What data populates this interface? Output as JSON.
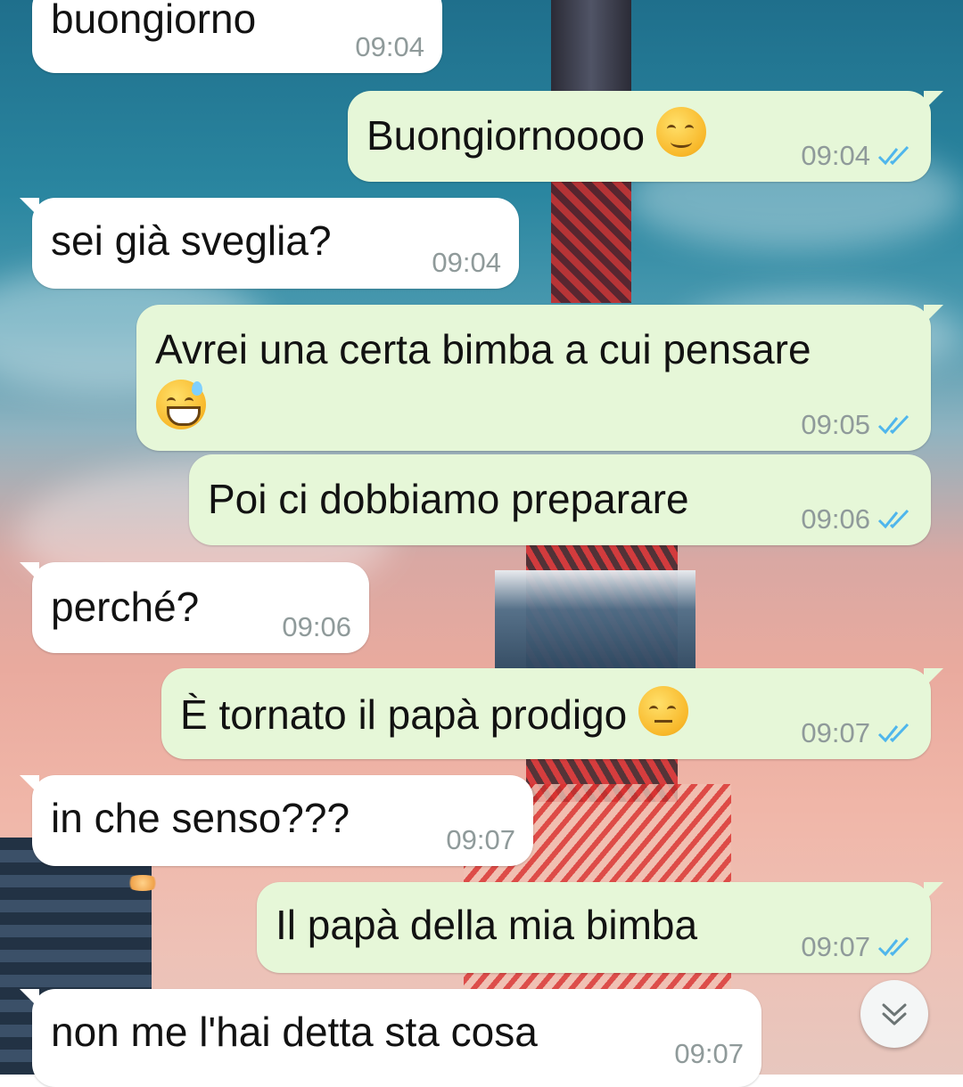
{
  "chat": {
    "messages": [
      {
        "direction": "incoming",
        "text": "buongiorno",
        "time": "09:04"
      },
      {
        "direction": "outgoing",
        "text": "Buongiornoooo",
        "emoji": "relieved-face-emoji",
        "time": "09:04",
        "status": "read"
      },
      {
        "direction": "incoming",
        "text": "sei già sveglia?",
        "time": "09:04"
      },
      {
        "direction": "outgoing",
        "text": "Avrei una certa bimba a cui pensare",
        "emoji": "grinning-sweat-face-emoji",
        "time": "09:05",
        "status": "read"
      },
      {
        "direction": "outgoing",
        "text": "Poi ci dobbiamo preparare",
        "time": "09:06",
        "status": "read"
      },
      {
        "direction": "incoming",
        "text": "perché?",
        "time": "09:06"
      },
      {
        "direction": "outgoing",
        "text": "È tornato il papà prodigo",
        "emoji": "unamused-face-emoji",
        "time": "09:07",
        "status": "read"
      },
      {
        "direction": "incoming",
        "text": "in che senso???",
        "time": "09:07"
      },
      {
        "direction": "outgoing",
        "text": "Il papà della mia bimba",
        "time": "09:07",
        "status": "read"
      },
      {
        "direction": "incoming",
        "text": "non me l'hai detta sta cosa",
        "time": "09:07"
      }
    ]
  },
  "scroll_button": {
    "icon": "double-chevron-down-icon"
  },
  "colors": {
    "incoming_bubble": "#ffffff",
    "outgoing_bubble": "#e6f7d8",
    "timestamp": "#8f9a9a",
    "read_tick": "#4fb6ec"
  }
}
